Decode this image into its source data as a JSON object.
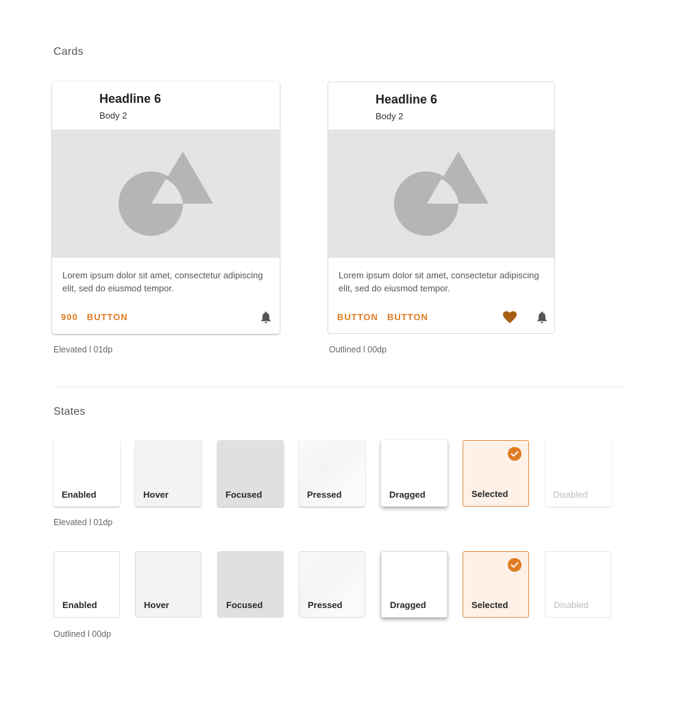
{
  "cards_section": {
    "title": "Cards",
    "cards": [
      {
        "headline": "Headline 6",
        "body": "Body 2",
        "supporting_text": "Lorem ipsum dolor sit amet, consectetur adipiscing elit, sed do eiusmod tempor.",
        "actions": [
          "900",
          "BUTTON"
        ],
        "icons": [
          "bell-icon"
        ],
        "caption": "Elevated l 01dp"
      },
      {
        "headline": "Headline 6",
        "body": "Body 2",
        "supporting_text": "Lorem ipsum dolor sit amet, consectetur adipiscing elit, sed do eiusmod tempor.",
        "actions": [
          "BUTTON",
          "BUTTON"
        ],
        "icons": [
          "heart-icon",
          "bell-icon"
        ],
        "caption": "Outlined l 00dp"
      }
    ]
  },
  "states_section": {
    "title": "States",
    "elevated_row": {
      "states": [
        "Enabled",
        "Hover",
        "Focused",
        "Pressed",
        "Dragged",
        "Selected",
        "Disabled"
      ],
      "caption": "Elevated l 01dp"
    },
    "outlined_row": {
      "states": [
        "Enabled",
        "Hover",
        "Focused",
        "Pressed",
        "Dragged",
        "Selected",
        "Disabled"
      ],
      "caption": "Outlined l 00dp"
    }
  },
  "colors": {
    "accent": "#e07c22",
    "heart": "#a85f12",
    "icon_gray": "#555555",
    "media_bg": "#e4e4e4",
    "placeholder_shape": "#b5b5b5"
  }
}
